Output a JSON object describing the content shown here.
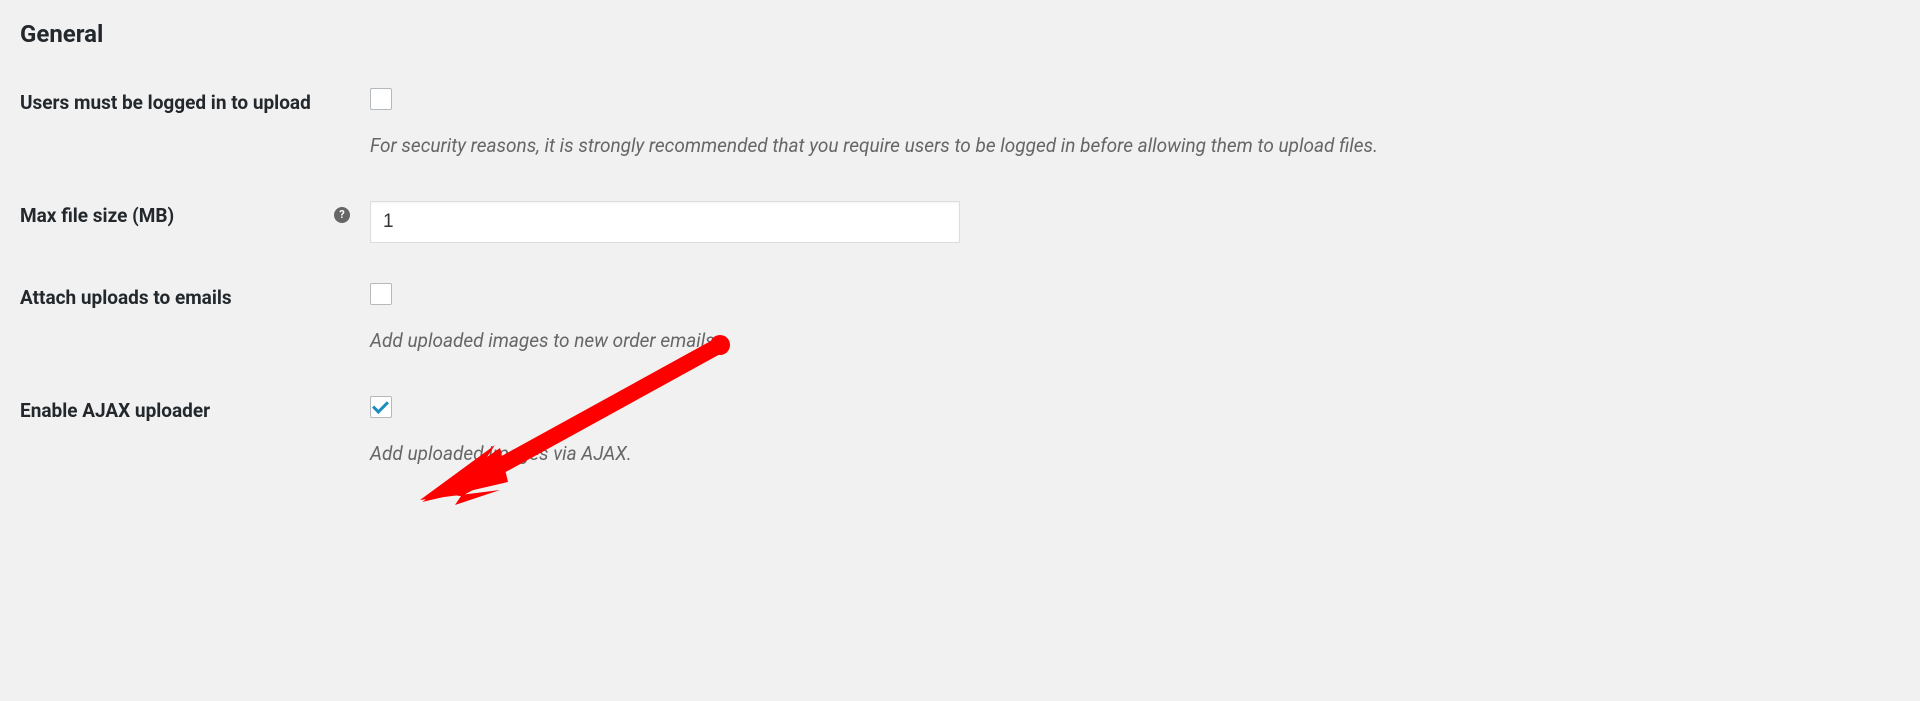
{
  "section": {
    "heading": "General"
  },
  "fields": {
    "logged_in": {
      "label": "Users must be logged in to upload",
      "checked": false,
      "description": "For security reasons, it is strongly recommended that you require users to be logged in before allowing them to upload files."
    },
    "max_file_size": {
      "label": "Max file size (MB)",
      "value": "1",
      "help_icon": "?"
    },
    "attach_emails": {
      "label": "Attach uploads to emails",
      "checked": false,
      "description": "Add uploaded images to new order emails."
    },
    "enable_ajax": {
      "label": "Enable AJAX uploader",
      "checked": true,
      "description": "Add uploaded images via AJAX."
    }
  }
}
